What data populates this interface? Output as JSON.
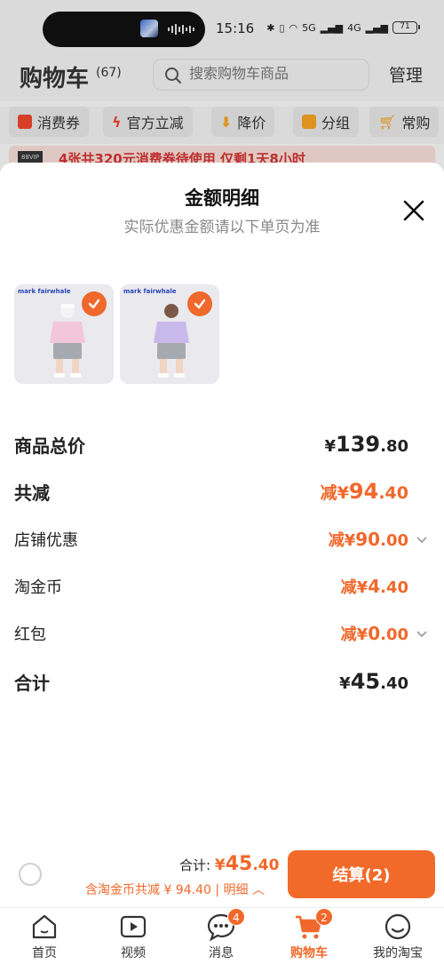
{
  "status": {
    "time": "15:16",
    "network": "5G",
    "network2": "4G",
    "battery": "71"
  },
  "header": {
    "title": "购物车",
    "count": "(67)",
    "search_placeholder": "搜索购物车商品",
    "manage": "管理"
  },
  "chips": [
    "消费券",
    "官方立减",
    "降价",
    "分组",
    "常购"
  ],
  "promo": {
    "vip": "88VIP",
    "text": "4张共320元消费券待使用 仅剩1天8小时"
  },
  "sheet": {
    "title": "金额明细",
    "subtitle": "实际优惠金额请以下单页为准",
    "thumb_logo_1": "mark fairwhale",
    "thumb_logo_2": "mark fairwhale",
    "rows": [
      {
        "label": "商品总价",
        "prefix": "",
        "currency": "¥",
        "int": "139",
        "dec": ".80"
      },
      {
        "label": "共减",
        "prefix": "减",
        "currency": "¥",
        "int": "94",
        "dec": ".40"
      },
      {
        "label": "店铺优惠",
        "prefix": "减",
        "currency": "¥",
        "int": "90",
        "dec": ".00"
      },
      {
        "label": "淘金币",
        "prefix": "减",
        "currency": "¥",
        "int": "4",
        "dec": ".40"
      },
      {
        "label": "红包",
        "prefix": "减",
        "currency": "¥",
        "int": "0",
        "dec": ".00"
      },
      {
        "label": "合计",
        "prefix": "",
        "currency": "¥",
        "int": "45",
        "dec": ".40"
      }
    ]
  },
  "bottom": {
    "total_label": "合计:",
    "total_currency": "¥",
    "total_int": "45",
    "total_dec": ".40",
    "deduct_text": "含淘金币共减 ¥ 94.40 | 明细",
    "checkout": "结算(2)"
  },
  "tabs": [
    {
      "label": "首页",
      "icon": "home-icon"
    },
    {
      "label": "视频",
      "icon": "video-icon"
    },
    {
      "label": "消息",
      "icon": "message-icon",
      "badge": "4"
    },
    {
      "label": "购物车",
      "icon": "cart-icon",
      "badge": "2"
    },
    {
      "label": "我的淘宝",
      "icon": "profile-icon"
    }
  ],
  "colors": {
    "accent": "#f0682b",
    "promo_red": "#cc3333"
  }
}
